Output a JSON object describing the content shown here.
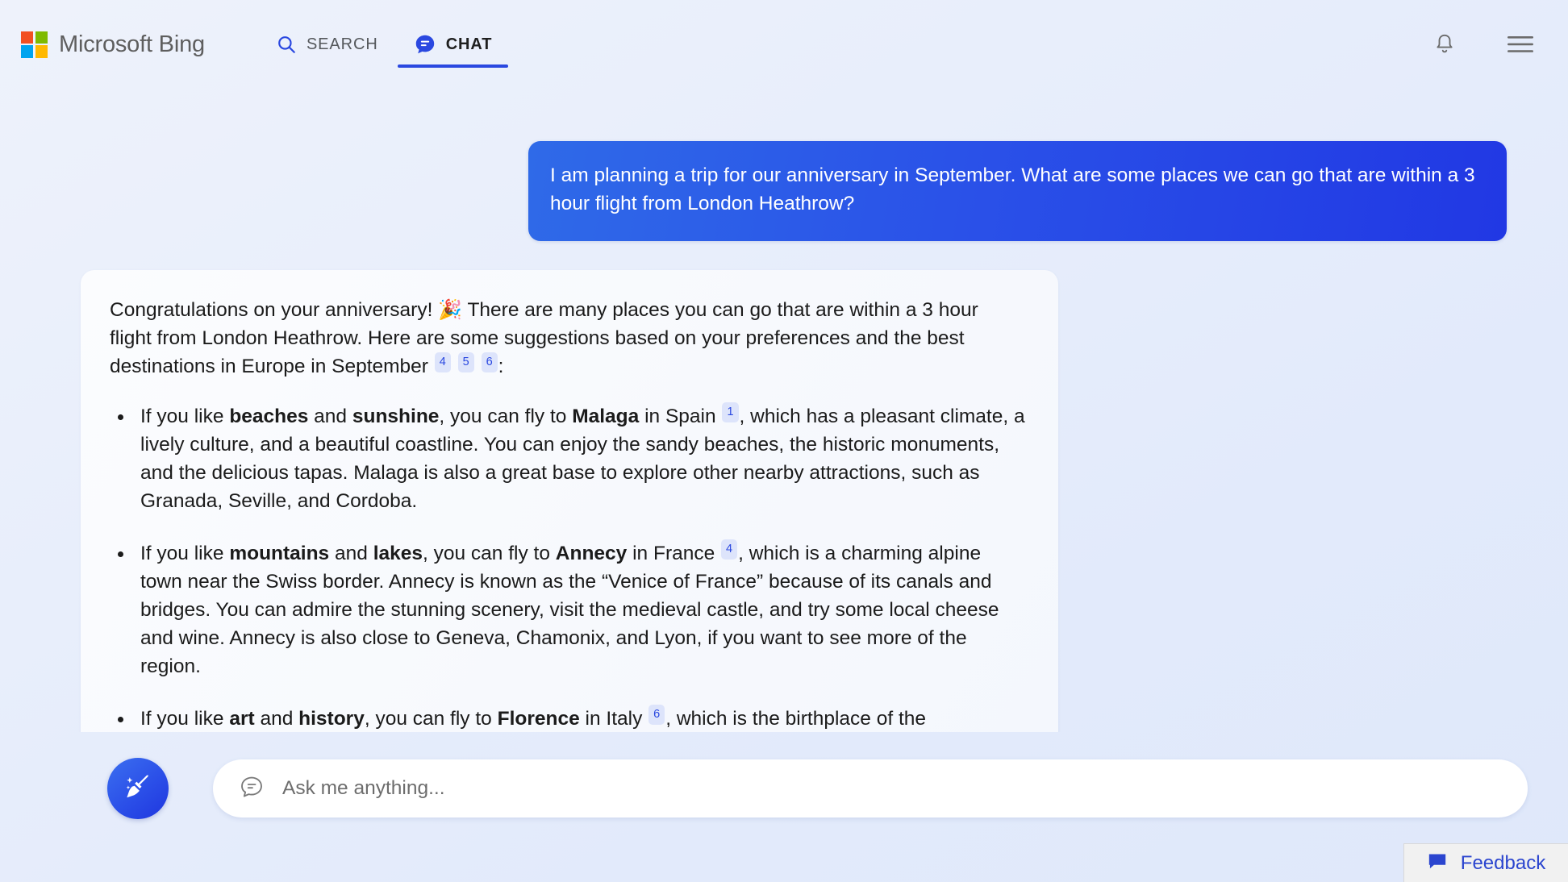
{
  "header": {
    "brand": "Microsoft Bing",
    "logo_colors": [
      "#f25022",
      "#7fba00",
      "#00a4ef",
      "#ffb900"
    ],
    "tabs": [
      {
        "label": "SEARCH",
        "icon": "search-icon",
        "active": false
      },
      {
        "label": "CHAT",
        "icon": "chat-bubble-icon",
        "active": true
      }
    ],
    "actions": [
      {
        "name": "notifications-icon",
        "label": "Notifications"
      },
      {
        "name": "hamburger-menu-icon",
        "label": "Menu"
      }
    ],
    "accent_color": "#2a48e0"
  },
  "conversation": {
    "user_message": "I am planning a trip for our anniversary in September. What are some places we can go that are within a 3 hour flight from London Heathrow?",
    "response": {
      "intro_part1": "Congratulations on your anniversary!",
      "intro_emoji": "🎉",
      "intro_part2": "There are many places you can go that are within a 3 hour flight from London Heathrow. Here are some suggestions based on your preferences and the best destinations in Europe in September",
      "intro_citations": [
        "4",
        "5",
        "6"
      ],
      "intro_end": ":",
      "bullets": [
        {
          "lead": "If you like ",
          "bold1": "beaches",
          "mid1": " and ",
          "bold2": "sunshine",
          "mid2": ", you can fly to ",
          "bold3": "Malaga",
          "mid3": " in Spain",
          "citation": "1",
          "rest": ", which has a pleasant climate, a lively culture, and a beautiful coastline. You can enjoy the sandy beaches, the historic monuments, and the delicious tapas. Malaga is also a great base to explore other nearby attractions, such as Granada, Seville, and Cordoba."
        },
        {
          "lead": "If you like ",
          "bold1": "mountains",
          "mid1": " and ",
          "bold2": "lakes",
          "mid2": ", you can fly to ",
          "bold3": "Annecy",
          "mid3": " in France",
          "citation": "4",
          "rest": ", which is a charming alpine town near the Swiss border. Annecy is known as the “Venice of France” because of its canals and bridges. You can admire the stunning scenery, visit the medieval castle, and try some local cheese and wine. Annecy is also close to Geneva, Chamonix, and Lyon, if you want to see more of the region."
        },
        {
          "lead": "If you like ",
          "bold1": "art",
          "mid1": " and ",
          "bold2": "history",
          "mid2": ", you can fly to ",
          "bold3": "Florence",
          "mid3": " in Italy",
          "citation": "6",
          "rest": ", which is the birthplace of the Renaissance and a UNESCO World Heritage Site. Florence is a treasure trove of artistic and architectural masterpieces, such as the Duomo, the Uffizi Gallery, and the Ponte Vecchio. You can also explore the Tuscan countryside, taste the famous gelato, and shop for leather goods."
        }
      ]
    }
  },
  "composer": {
    "new_topic_icon": "broom-sweep-icon",
    "input_icon": "chat-bubble-outline-icon",
    "placeholder": "Ask me anything...",
    "value": ""
  },
  "feedback": {
    "label": "Feedback",
    "icon": "feedback-speech-bubble-icon",
    "color": "#2b45cf"
  }
}
